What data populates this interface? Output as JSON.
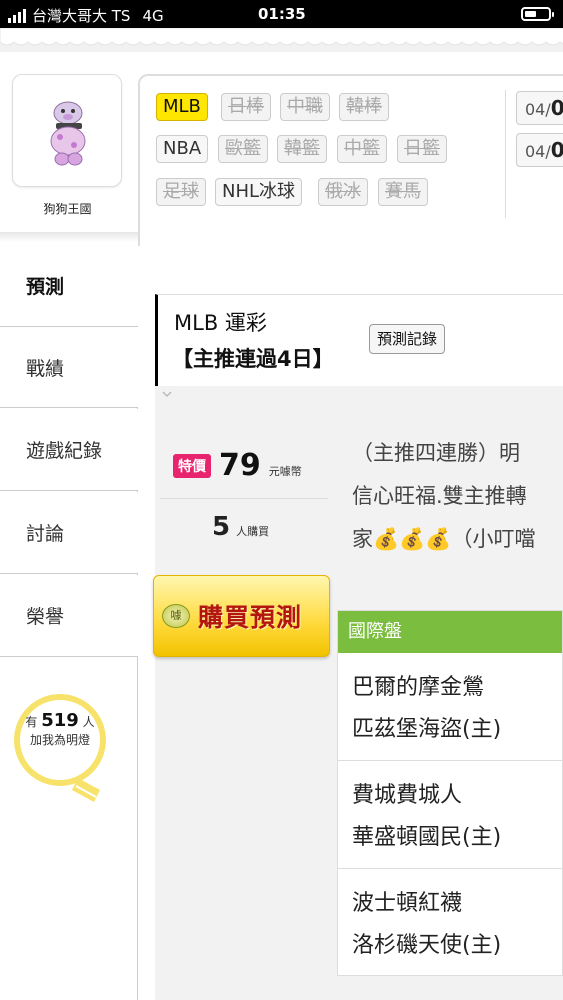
{
  "status_bar": {
    "carrier": "台灣大哥大 TS",
    "network": "4G",
    "time": "01:35",
    "battery_level": 0.5
  },
  "profile": {
    "name": "狗狗王國"
  },
  "sidebar": {
    "items": [
      {
        "label": "預測",
        "active": true
      },
      {
        "label": "戰績",
        "active": false
      },
      {
        "label": "遊戲紀錄",
        "active": false
      },
      {
        "label": "討論",
        "active": false
      },
      {
        "label": "榮譽",
        "active": false
      }
    ],
    "light": {
      "prefix": "有",
      "count": "519",
      "suffix": "人",
      "caption": "加我為明燈"
    }
  },
  "categories": [
    {
      "label": "MLB",
      "state": "selected"
    },
    {
      "label": "日棒",
      "state": "disabled"
    },
    {
      "label": "中職",
      "state": "disabled"
    },
    {
      "label": "韓棒",
      "state": "disabled"
    },
    {
      "label": "NBA",
      "state": "normal"
    },
    {
      "label": "歐籃",
      "state": "disabled"
    },
    {
      "label": "韓籃",
      "state": "disabled"
    },
    {
      "label": "中籃",
      "state": "disabled"
    },
    {
      "label": "日籃",
      "state": "disabled"
    },
    {
      "label": "足球",
      "state": "disabled"
    },
    {
      "label": "NHL冰球",
      "state": "normal"
    },
    {
      "label": "俄冰",
      "state": "disabled"
    },
    {
      "label": "賽馬",
      "state": "disabled"
    }
  ],
  "dates": [
    {
      "month": "04/",
      "day": "0"
    },
    {
      "month": "04/",
      "day": "0"
    }
  ],
  "header": {
    "title": "MLB 運彩",
    "subtitle": "【主推連過4日】",
    "record_button": "預測記錄"
  },
  "offer": {
    "tag": "特價",
    "price": "79",
    "price_unit": "元噱幣",
    "buyers": "5",
    "buyers_unit": "人購買",
    "buy_icon": "噱",
    "buy_button": "購買預測"
  },
  "description": {
    "lines": [
      "（主推四連勝）明",
      "信心旺福.雙主推轉",
      "家💰💰💰（小叮噹"
    ]
  },
  "games": {
    "header": "國際盤",
    "rows": [
      {
        "away": "巴爾的摩金鶯",
        "home": "匹茲堡海盜(主)"
      },
      {
        "away": "費城費城人",
        "home": "華盛頓國民(主)"
      },
      {
        "away": "波士頓紅襪",
        "home": "洛杉磯天使(主)"
      }
    ]
  }
}
